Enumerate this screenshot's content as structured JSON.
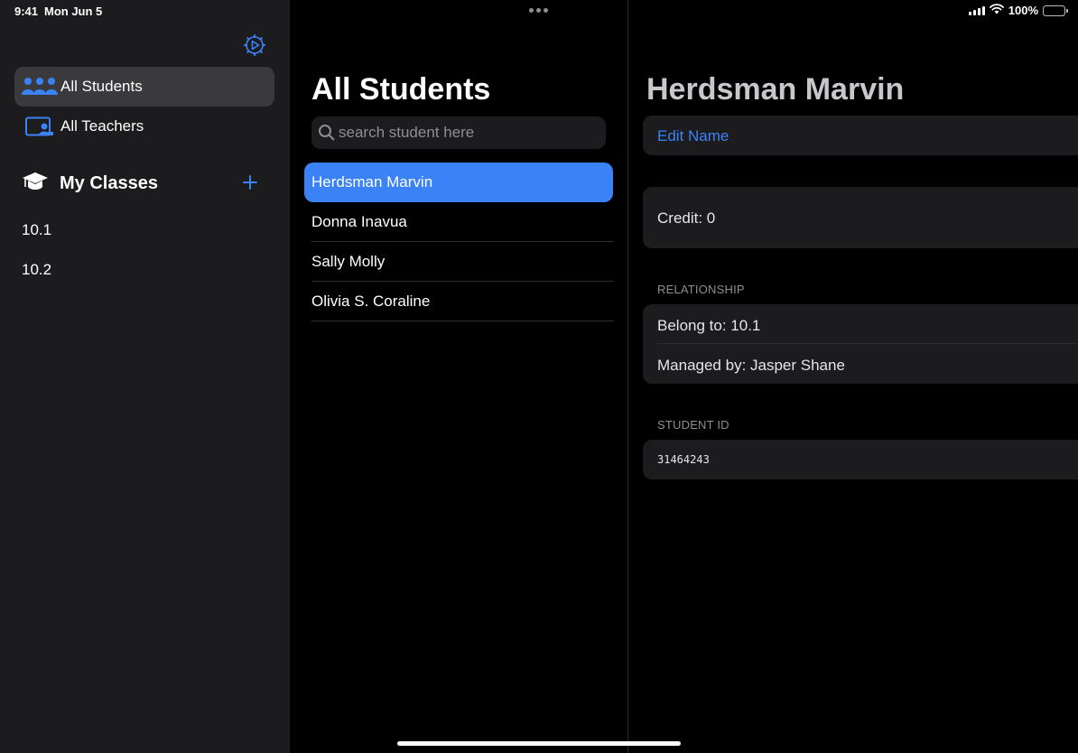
{
  "status_bar": {
    "time": "9:41",
    "date": "Mon Jun 5",
    "battery": "100%"
  },
  "sidebar": {
    "items": [
      {
        "label": "All Students",
        "icon": "people-icon",
        "selected": true
      },
      {
        "label": "All Teachers",
        "icon": "teacher-icon",
        "selected": false
      }
    ],
    "section_title": "My Classes",
    "classes": [
      "10.1",
      "10.2"
    ]
  },
  "list": {
    "title": "All Students",
    "search_placeholder": "search student here",
    "students": [
      "Herdsman Marvin",
      "Donna Inavua",
      "Sally Molly",
      "Olivia S. Coraline"
    ],
    "selected_index": 0
  },
  "detail": {
    "title": "Herdsman Marvin",
    "edit_name": "Edit Name",
    "credit": "Credit: 0",
    "relationship_label": "RELATIONSHIP",
    "belong_to": "Belong to:  10.1",
    "managed_by": "Managed by:  Jasper Shane",
    "student_id_label": "STUDENT ID",
    "student_id": "31464243"
  },
  "colors": {
    "accent": "#3a82f6",
    "sidebar_bg": "#1c1c1e",
    "background": "#000000"
  }
}
